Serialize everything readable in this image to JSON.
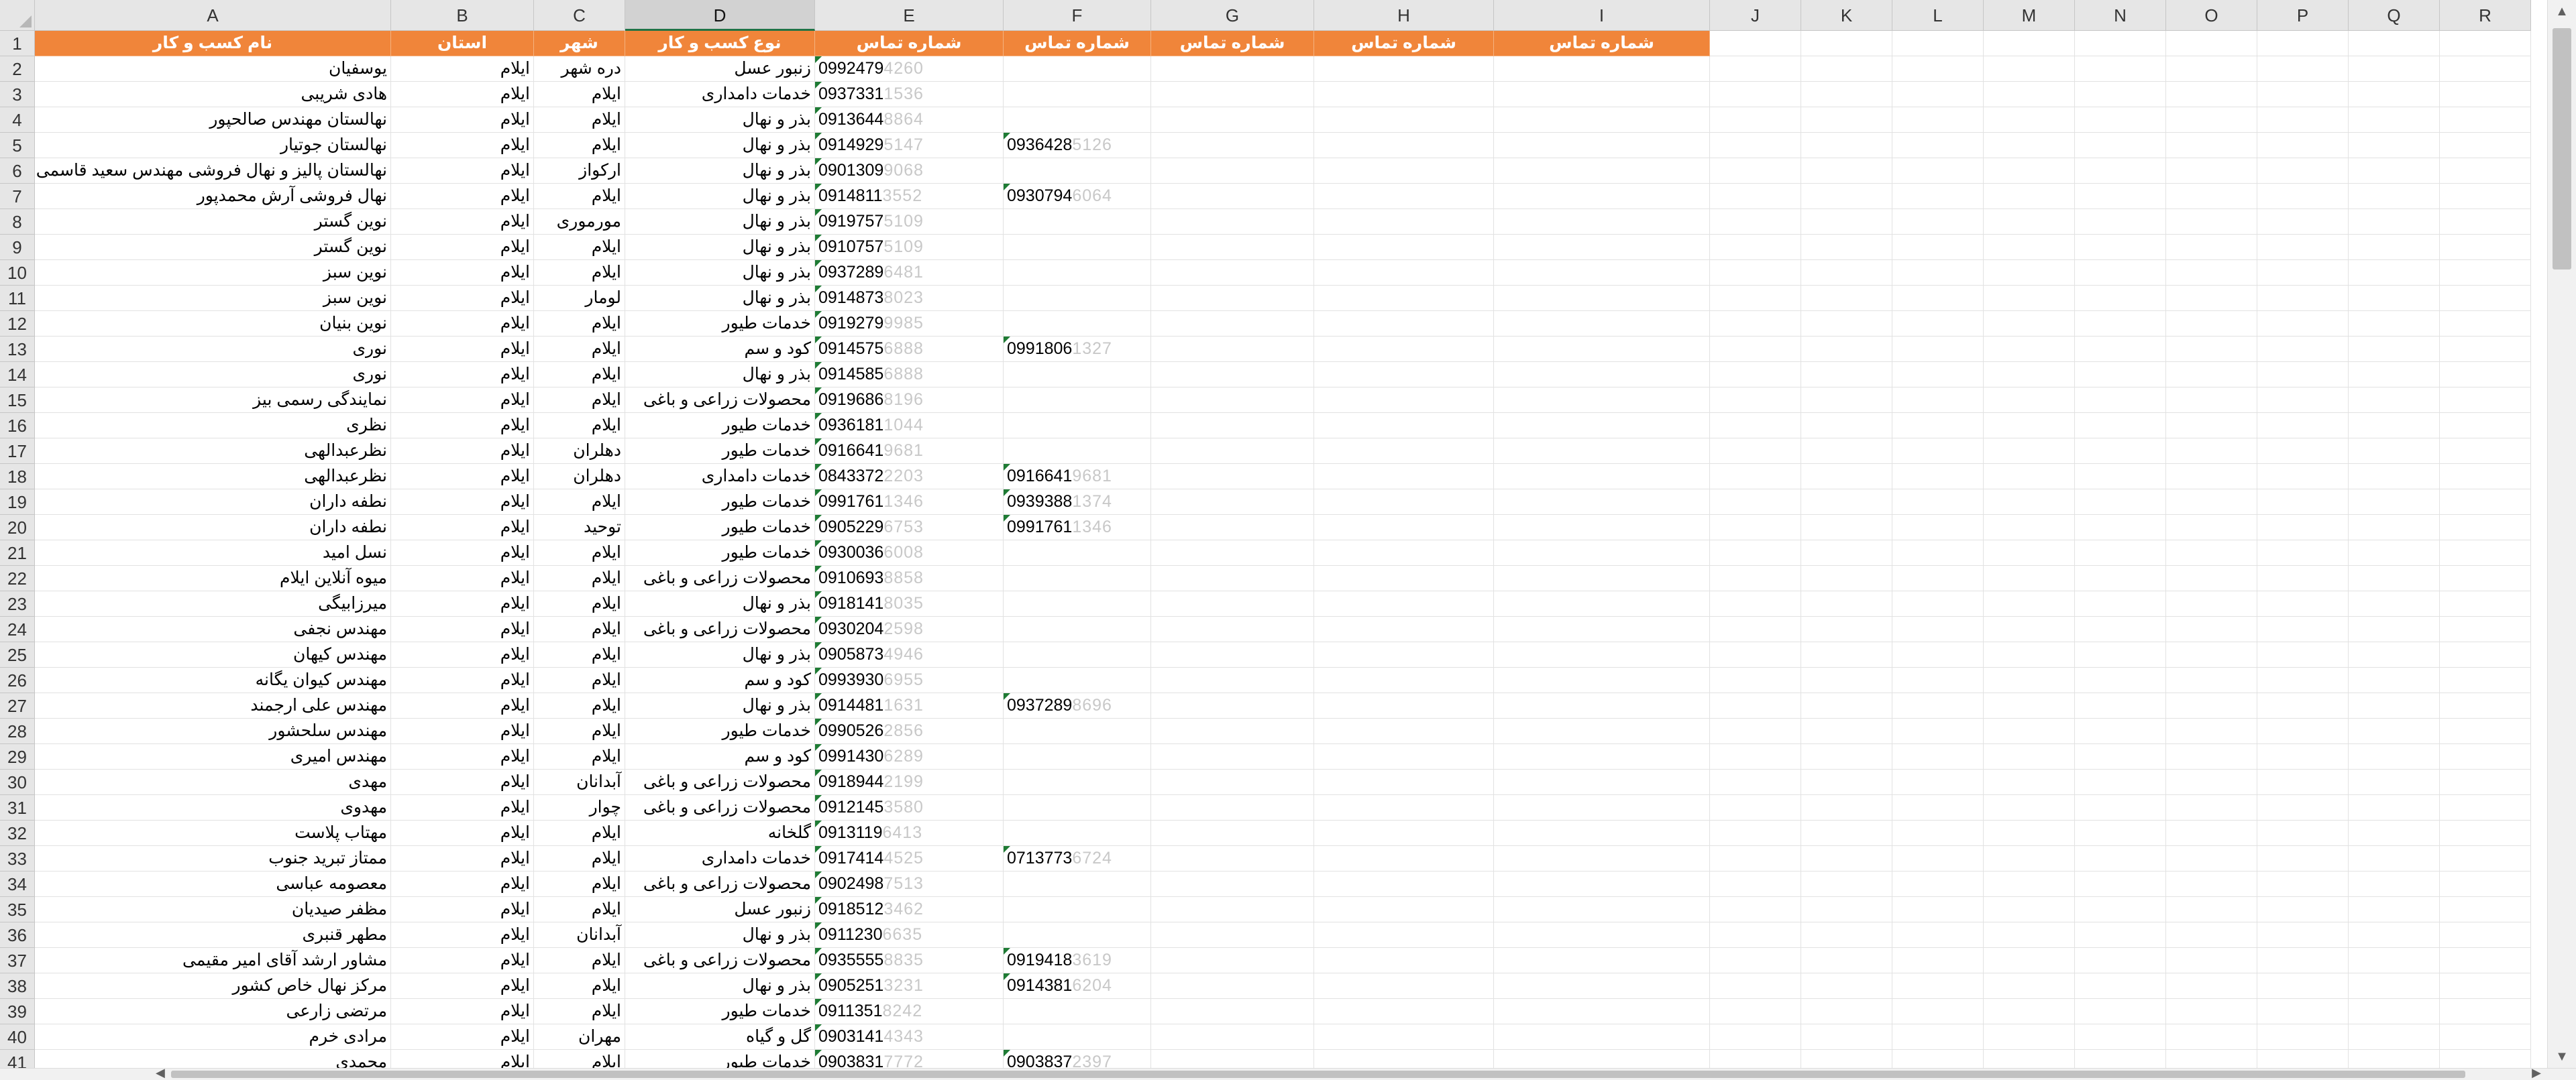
{
  "spreadsheet": {
    "selected_column": "D",
    "columns": [
      {
        "letter": "A"
      },
      {
        "letter": "B"
      },
      {
        "letter": "C"
      },
      {
        "letter": "D"
      },
      {
        "letter": "E"
      },
      {
        "letter": "F"
      },
      {
        "letter": "G"
      },
      {
        "letter": "H"
      },
      {
        "letter": "I"
      },
      {
        "letter": "J"
      },
      {
        "letter": "K"
      },
      {
        "letter": "L"
      },
      {
        "letter": "M"
      },
      {
        "letter": "N"
      },
      {
        "letter": "O"
      },
      {
        "letter": "P"
      },
      {
        "letter": "Q"
      },
      {
        "letter": "R"
      }
    ],
    "header_fill_color": "#f0853a",
    "error_flag_color": "#1e7b34",
    "header_row": [
      "نام کسب و کار",
      "استان",
      "شهر",
      "نوع کسب و کار",
      "شماره تماس",
      "شماره تماس",
      "شماره تماس",
      "شماره تماس",
      "شماره تماس"
    ],
    "rows": [
      {
        "num": "2",
        "name": "یوسفیان",
        "province": "ایلام",
        "city": "دره شهر",
        "type": "زنبور عسل",
        "phone1": "0992479",
        "phone1_blur": "4260",
        "phone2": "",
        "phone2_blur": ""
      },
      {
        "num": "3",
        "name": "هادی شریبی",
        "province": "ایلام",
        "city": "ایلام",
        "type": "خدمات دامداری",
        "phone1": "0937331",
        "phone1_blur": "1536",
        "phone2": "",
        "phone2_blur": ""
      },
      {
        "num": "4",
        "name": "نهالستان مهندس صالحپور",
        "province": "ایلام",
        "city": "ایلام",
        "type": "بذر و نهال",
        "phone1": "0913644",
        "phone1_blur": "8864",
        "phone2": "",
        "phone2_blur": ""
      },
      {
        "num": "5",
        "name": "نهالستان جوتیار",
        "province": "ایلام",
        "city": "ایلام",
        "type": "بذر و نهال",
        "phone1": "0914929",
        "phone1_blur": "5147",
        "phone2": "0936428",
        "phone2_blur": "5126"
      },
      {
        "num": "6",
        "name": "نهالستان پالیز و نهال فروشی مهندس سعید قاسمی",
        "province": "ایلام",
        "city": "ارکواز",
        "type": "بذر و نهال",
        "phone1": "0901309",
        "phone1_blur": "9068",
        "phone2": "",
        "phone2_blur": ""
      },
      {
        "num": "7",
        "name": "نهال فروشی آرش محمدپور",
        "province": "ایلام",
        "city": "ایلام",
        "type": "بذر و نهال",
        "phone1": "0914811",
        "phone1_blur": "3552",
        "phone2": "0930794",
        "phone2_blur": "6064"
      },
      {
        "num": "8",
        "name": "نوین گستر",
        "province": "ایلام",
        "city": "مورموری",
        "type": "بذر و نهال",
        "phone1": "0919757",
        "phone1_blur": "5109",
        "phone2": "",
        "phone2_blur": ""
      },
      {
        "num": "9",
        "name": "نوین گستر",
        "province": "ایلام",
        "city": "ایلام",
        "type": "بذر و نهال",
        "phone1": "0910757",
        "phone1_blur": "5109",
        "phone2": "",
        "phone2_blur": ""
      },
      {
        "num": "10",
        "name": "نوین سبز",
        "province": "ایلام",
        "city": "ایلام",
        "type": "بذر و نهال",
        "phone1": "0937289",
        "phone1_blur": "6481",
        "phone2": "",
        "phone2_blur": ""
      },
      {
        "num": "11",
        "name": "نوین سبز",
        "province": "ایلام",
        "city": "لومار",
        "type": "بذر و نهال",
        "phone1": "0914873",
        "phone1_blur": "8023",
        "phone2": "",
        "phone2_blur": ""
      },
      {
        "num": "12",
        "name": "نوین بنیان",
        "province": "ایلام",
        "city": "ایلام",
        "type": "خدمات طیور",
        "phone1": "0919279",
        "phone1_blur": "9985",
        "phone2": "",
        "phone2_blur": ""
      },
      {
        "num": "13",
        "name": "نوری",
        "province": "ایلام",
        "city": "ایلام",
        "type": "کود و سم",
        "phone1": "0914575",
        "phone1_blur": "6888",
        "phone2": "0991806",
        "phone2_blur": "1327"
      },
      {
        "num": "14",
        "name": "نوری",
        "province": "ایلام",
        "city": "ایلام",
        "type": "بذر و نهال",
        "phone1": "0914585",
        "phone1_blur": "6888",
        "phone2": "",
        "phone2_blur": ""
      },
      {
        "num": "15",
        "name": "نمایندگی رسمی بیز",
        "province": "ایلام",
        "city": "ایلام",
        "type": "محصولات زراعی و باغی",
        "phone1": "0919686",
        "phone1_blur": "8196",
        "phone2": "",
        "phone2_blur": ""
      },
      {
        "num": "16",
        "name": "نظری",
        "province": "ایلام",
        "city": "ایلام",
        "type": "خدمات طیور",
        "phone1": "0936181",
        "phone1_blur": "1044",
        "phone2": "",
        "phone2_blur": ""
      },
      {
        "num": "17",
        "name": "نظرعبدالهی",
        "province": "ایلام",
        "city": "دهلران",
        "type": "خدمات طیور",
        "phone1": "0916641",
        "phone1_blur": "9681",
        "phone2": "",
        "phone2_blur": ""
      },
      {
        "num": "18",
        "name": "نظرعبدالهی",
        "province": "ایلام",
        "city": "دهلران",
        "type": "خدمات دامداری",
        "phone1": "0843372",
        "phone1_blur": "2203",
        "phone2": "0916641",
        "phone2_blur": "9681"
      },
      {
        "num": "19",
        "name": "نطفه داران",
        "province": "ایلام",
        "city": "ایلام",
        "type": "خدمات طیور",
        "phone1": "0991761",
        "phone1_blur": "1346",
        "phone2": "0939388",
        "phone2_blur": "1374"
      },
      {
        "num": "20",
        "name": "نطفه داران",
        "province": "ایلام",
        "city": "توحید",
        "type": "خدمات طیور",
        "phone1": "0905229",
        "phone1_blur": "6753",
        "phone2": "0991761",
        "phone2_blur": "1346"
      },
      {
        "num": "21",
        "name": "نسل امید",
        "province": "ایلام",
        "city": "ایلام",
        "type": "خدمات طیور",
        "phone1": "0930036",
        "phone1_blur": "6008",
        "phone2": "",
        "phone2_blur": ""
      },
      {
        "num": "22",
        "name": "میوه آنلاین ایلام",
        "province": "ایلام",
        "city": "ایلام",
        "type": "محصولات زراعی و باغی",
        "phone1": "0910693",
        "phone1_blur": "8858",
        "phone2": "",
        "phone2_blur": ""
      },
      {
        "num": "23",
        "name": "میرزابیگی",
        "province": "ایلام",
        "city": "ایلام",
        "type": "بذر و نهال",
        "phone1": "0918141",
        "phone1_blur": "8035",
        "phone2": "",
        "phone2_blur": ""
      },
      {
        "num": "24",
        "name": "مهندس نجفی",
        "province": "ایلام",
        "city": "ایلام",
        "type": "محصولات زراعی و باغی",
        "phone1": "0930204",
        "phone1_blur": "2598",
        "phone2": "",
        "phone2_blur": ""
      },
      {
        "num": "25",
        "name": "مهندس کیهان",
        "province": "ایلام",
        "city": "ایلام",
        "type": "بذر و نهال",
        "phone1": "0905873",
        "phone1_blur": "4946",
        "phone2": "",
        "phone2_blur": ""
      },
      {
        "num": "26",
        "name": "مهندس کیوان یگانه",
        "province": "ایلام",
        "city": "ایلام",
        "type": "کود و سم",
        "phone1": "0993930",
        "phone1_blur": "6955",
        "phone2": "",
        "phone2_blur": ""
      },
      {
        "num": "27",
        "name": "مهندس علی ارجمند",
        "province": "ایلام",
        "city": "ایلام",
        "type": "بذر و نهال",
        "phone1": "0914481",
        "phone1_blur": "1631",
        "phone2": "0937289",
        "phone2_blur": "8696"
      },
      {
        "num": "28",
        "name": "مهندس سلحشور",
        "province": "ایلام",
        "city": "ایلام",
        "type": "خدمات طیور",
        "phone1": "0990526",
        "phone1_blur": "2856",
        "phone2": "",
        "phone2_blur": ""
      },
      {
        "num": "29",
        "name": "مهندس امیری",
        "province": "ایلام",
        "city": "ایلام",
        "type": "کود و سم",
        "phone1": "0991430",
        "phone1_blur": "6289",
        "phone2": "",
        "phone2_blur": ""
      },
      {
        "num": "30",
        "name": "مهدی",
        "province": "ایلام",
        "city": "آبدانان",
        "type": "محصولات زراعی و باغی",
        "phone1": "0918944",
        "phone1_blur": "2199",
        "phone2": "",
        "phone2_blur": ""
      },
      {
        "num": "31",
        "name": "مهدوی",
        "province": "ایلام",
        "city": "چوار",
        "type": "محصولات زراعی و باغی",
        "phone1": "0912145",
        "phone1_blur": "3580",
        "phone2": "",
        "phone2_blur": ""
      },
      {
        "num": "32",
        "name": "مهتاب پلاست",
        "province": "ایلام",
        "city": "ایلام",
        "type": "گلخانه",
        "phone1": "0913119",
        "phone1_blur": "6413",
        "phone2": "",
        "phone2_blur": ""
      },
      {
        "num": "33",
        "name": "ممتاز تبرید جنوب",
        "province": "ایلام",
        "city": "ایلام",
        "type": "خدمات دامداری",
        "phone1": "0917414",
        "phone1_blur": "4525",
        "phone2": "0713773",
        "phone2_blur": "6724"
      },
      {
        "num": "34",
        "name": "معصومه عباسی",
        "province": "ایلام",
        "city": "ایلام",
        "type": "محصولات زراعی و باغی",
        "phone1": "0902498",
        "phone1_blur": "7513",
        "phone2": "",
        "phone2_blur": ""
      },
      {
        "num": "35",
        "name": "مظفر صیدیان",
        "province": "ایلام",
        "city": "ایلام",
        "type": "زنبور عسل",
        "phone1": "0918512",
        "phone1_blur": "3462",
        "phone2": "",
        "phone2_blur": ""
      },
      {
        "num": "36",
        "name": "مطهر قنبری",
        "province": "ایلام",
        "city": "آبدانان",
        "type": "بذر و نهال",
        "phone1": "0911230",
        "phone1_blur": "6635",
        "phone2": "",
        "phone2_blur": ""
      },
      {
        "num": "37",
        "name": "مشاور ارشد آقای امیر مقیمی",
        "province": "ایلام",
        "city": "ایلام",
        "type": "محصولات زراعی و باغی",
        "phone1": "0935555",
        "phone1_blur": "8835",
        "phone2": "0919418",
        "phone2_blur": "3619"
      },
      {
        "num": "38",
        "name": "مرکز نهال خاص کشور",
        "province": "ایلام",
        "city": "ایلام",
        "type": "بذر و نهال",
        "phone1": "0905251",
        "phone1_blur": "3231",
        "phone2": "0914381",
        "phone2_blur": "6204"
      },
      {
        "num": "39",
        "name": "مرتضی زارعی",
        "province": "ایلام",
        "city": "ایلام",
        "type": "خدمات طیور",
        "phone1": "0911351",
        "phone1_blur": "8242",
        "phone2": "",
        "phone2_blur": ""
      },
      {
        "num": "40",
        "name": "مرادی خرم",
        "province": "ایلام",
        "city": "مهران",
        "type": "گل و گیاه",
        "phone1": "0903141",
        "phone1_blur": "4343",
        "phone2": "",
        "phone2_blur": ""
      },
      {
        "num": "41",
        "name": "محمدی",
        "province": "ایلام",
        "city": "ایلام",
        "type": "خدمات طیور",
        "phone1": "0903831",
        "phone1_blur": "7772",
        "phone2": "0903837",
        "phone2_blur": "2397"
      }
    ]
  }
}
